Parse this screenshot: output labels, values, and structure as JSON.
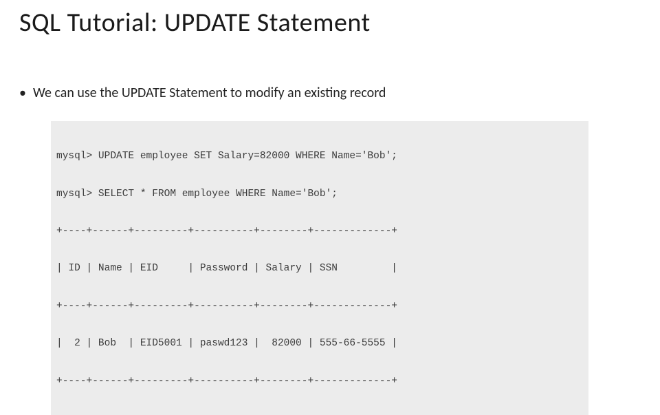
{
  "title": "SQL Tutorial: UPDATE Statement",
  "bullet": "We can use the UPDATE Statement to modify an existing record",
  "code": {
    "lines": [
      "mysql> UPDATE employee SET Salary=82000 WHERE Name='Bob';",
      "mysql> SELECT * FROM employee WHERE Name='Bob';",
      "+----+------+---------+----------+--------+-------------+",
      "| ID | Name | EID     | Password | Salary | SSN         |",
      "+----+------+---------+----------+--------+-------------+",
      "|  2 | Bob  | EID5001 | paswd123 |  82000 | 555-66-5555 |",
      "+----+------+---------+----------+--------+-------------+"
    ]
  },
  "table_data": {
    "columns": [
      "ID",
      "Name",
      "EID",
      "Password",
      "Salary",
      "SSN"
    ],
    "rows": [
      {
        "ID": 2,
        "Name": "Bob",
        "EID": "EID5001",
        "Password": "paswd123",
        "Salary": 82000,
        "SSN": "555-66-5555"
      }
    ]
  }
}
